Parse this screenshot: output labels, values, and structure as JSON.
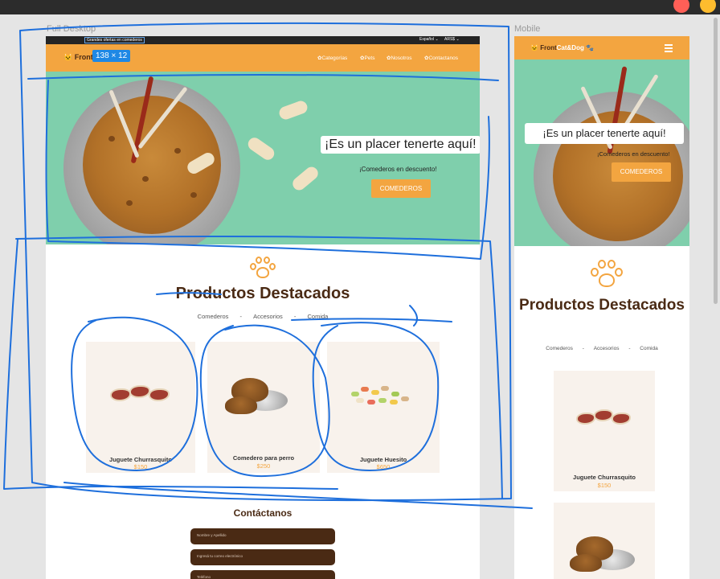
{
  "frames": {
    "desktop_label": "Full Desktop",
    "mobile_label": "Mobile"
  },
  "selection_badge": "138 × 12",
  "desktop": {
    "offer": "Grandes ofertas en comederos",
    "language": "Español ⌄",
    "currency": "ARS$ ⌄",
    "logo": "Front",
    "nav": [
      "Categorías",
      "Pets",
      "Nosotros",
      "Contactanos"
    ],
    "hero": {
      "title": "¡Es un placer tenerte aquí!",
      "subtitle": "¡Comederos en descuento!",
      "button": "COMEDEROS"
    },
    "products_title": "Productos Destacados",
    "filters": [
      "Comederos",
      "-",
      "Accesorios",
      "-",
      "Comida"
    ],
    "products": [
      {
        "name": "Juguete Churrasquito",
        "price": "$150"
      },
      {
        "name": "Comedero para perro",
        "price": "$250"
      },
      {
        "name": "Juguete Huesito",
        "price": "$650"
      }
    ],
    "contact_title": "Contáctanos",
    "contact_fields": [
      "Nombre y Apellido",
      "Ingresá tu correo electrónico",
      "Teléfono"
    ]
  },
  "mobile": {
    "logo_prefix": "Front",
    "logo_accent": "Cat&Dog",
    "hero": {
      "title": "¡Es un placer tenerte aquí!",
      "subtitle": "¡Comederos en descuento!",
      "button": "COMEDEROS"
    },
    "products_title": "Productos Destacados",
    "filters": [
      "Comederos",
      "-",
      "Accesorios",
      "-",
      "Comida"
    ],
    "products": [
      {
        "name": "Juguete Churrasquito",
        "price": "$150"
      }
    ]
  },
  "colors": {
    "accent": "#f3a540",
    "brown": "#4a2a14",
    "hero_green": "#7fcfac",
    "annotation": "#1e6fdc"
  }
}
